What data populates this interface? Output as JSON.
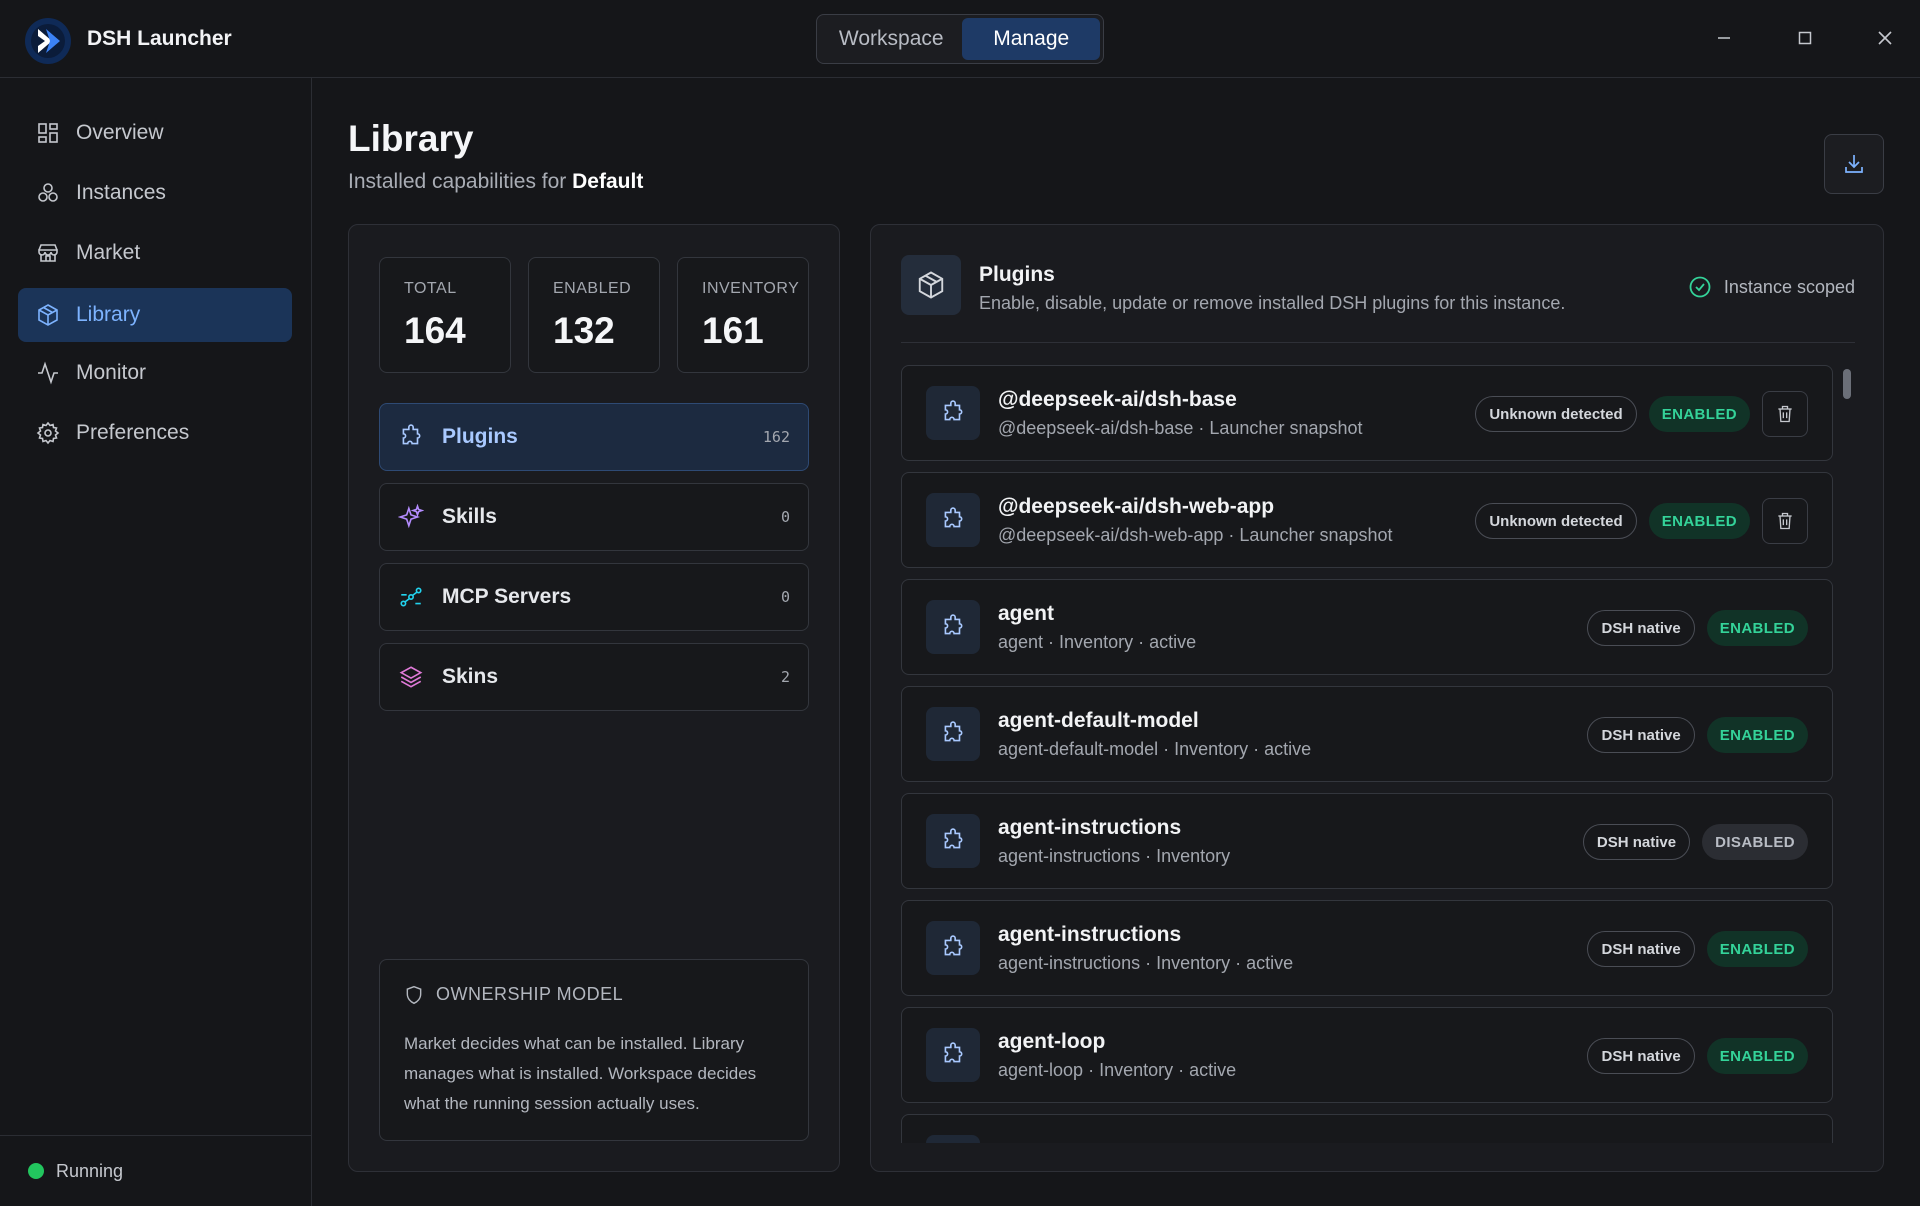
{
  "app": {
    "title": "DSH Launcher",
    "mode_tabs": [
      "Workspace",
      "Manage"
    ],
    "active_mode": "Manage"
  },
  "sidebar": {
    "items": [
      {
        "label": "Overview",
        "icon": "grid-icon"
      },
      {
        "label": "Instances",
        "icon": "cluster-icon"
      },
      {
        "label": "Market",
        "icon": "store-icon"
      },
      {
        "label": "Library",
        "icon": "package-icon",
        "active": true
      },
      {
        "label": "Monitor",
        "icon": "activity-icon"
      },
      {
        "label": "Preferences",
        "icon": "gear-icon"
      }
    ],
    "status": "Running"
  },
  "header": {
    "title": "Library",
    "subtitle_prefix": "Installed capabilities for",
    "subtitle_instance": "Default"
  },
  "stats": [
    {
      "label": "TOTAL",
      "value": "164"
    },
    {
      "label": "ENABLED",
      "value": "132"
    },
    {
      "label": "INVENTORY",
      "value": "161"
    }
  ],
  "categories": [
    {
      "label": "Plugins",
      "count": "162",
      "icon": "puzzle-icon",
      "active": true
    },
    {
      "label": "Skills",
      "count": "0",
      "icon": "sparkle-icon"
    },
    {
      "label": "MCP Servers",
      "count": "0",
      "icon": "network-icon"
    },
    {
      "label": "Skins",
      "count": "2",
      "icon": "layers-icon"
    }
  ],
  "ownership": {
    "title": "OWNERSHIP MODEL",
    "text": "Market decides what can be installed. Library manages what is installed. Workspace decides what the running session actually uses."
  },
  "panel": {
    "title": "Plugins",
    "description": "Enable, disable, update or remove installed DSH plugins for this instance.",
    "scope": "Instance scoped"
  },
  "plugins": [
    {
      "name": "@deepseek-ai/dsh-base",
      "meta": "@deepseek-ai/dsh-base · Launcher snapshot",
      "origin": "Unknown detected",
      "status": "ENABLED",
      "deletable": true
    },
    {
      "name": "@deepseek-ai/dsh-web-app",
      "meta": "@deepseek-ai/dsh-web-app · Launcher snapshot",
      "origin": "Unknown detected",
      "status": "ENABLED",
      "deletable": true
    },
    {
      "name": "agent",
      "meta": "agent · Inventory · active",
      "origin": "DSH native",
      "status": "ENABLED",
      "deletable": false
    },
    {
      "name": "agent-default-model",
      "meta": "agent-default-model · Inventory · active",
      "origin": "DSH native",
      "status": "ENABLED",
      "deletable": false
    },
    {
      "name": "agent-instructions",
      "meta": "agent-instructions · Inventory",
      "origin": "DSH native",
      "status": "DISABLED",
      "deletable": false
    },
    {
      "name": "agent-instructions",
      "meta": "agent-instructions · Inventory · active",
      "origin": "DSH native",
      "status": "ENABLED",
      "deletable": false
    },
    {
      "name": "agent-loop",
      "meta": "agent-loop · Inventory · active",
      "origin": "DSH native",
      "status": "ENABLED",
      "deletable": false
    }
  ],
  "colors": {
    "background": "#151619",
    "accent": "#7db3ff",
    "active_nav_bg": "#1b3458",
    "enabled": "#34d399",
    "running": "#22c55e"
  }
}
